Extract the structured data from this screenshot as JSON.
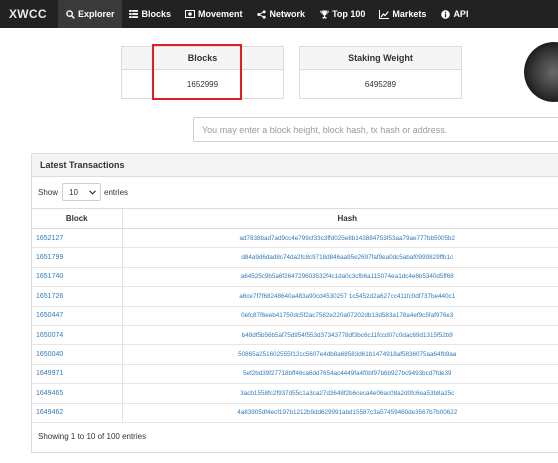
{
  "navbar": {
    "brand": "XWCC",
    "items": [
      {
        "label": "Explorer",
        "icon": "search-icon",
        "active": true
      },
      {
        "label": "Blocks",
        "icon": "grid-icon",
        "active": false
      },
      {
        "label": "Movement",
        "icon": "money-icon",
        "active": false
      },
      {
        "label": "Network",
        "icon": "share-icon",
        "active": false
      },
      {
        "label": "Top 100",
        "icon": "trophy-icon",
        "active": false
      },
      {
        "label": "Markets",
        "icon": "chart-icon",
        "active": false
      },
      {
        "label": "API",
        "icon": "info-icon",
        "active": false
      }
    ]
  },
  "stats": {
    "blocks": {
      "title": "Blocks",
      "value": "1652999"
    },
    "staking": {
      "title": "Staking Weight",
      "value": "6495289"
    }
  },
  "search": {
    "placeholder": "You may enter a block height, block hash, tx hash or address."
  },
  "transactions": {
    "title": "Latest Transactions",
    "show_label": "Show",
    "page_size": "10",
    "entries_label": "entries",
    "columns": {
      "block": "Block",
      "hash": "Hash"
    },
    "rows": [
      {
        "block": "1652127",
        "hash": "ad7838bad7ad9cc4e799cf33c3ffd025e8b143884753f53aa79ae777bb5005b2"
      },
      {
        "block": "1651799",
        "hash": "d84a9d6dad8c74da2fc8c9718d846aa95e2697faf9ea0dc5abaf0999829ffb1c"
      },
      {
        "block": "1651740",
        "hash": "a64525c9b5a6f264729603532f4c1da0c3cfb6a115074ea1dc4e6b5340d5ff68"
      },
      {
        "block": "1651726",
        "hash": "a6ce7f7f68248640a483a90cd4530257 1c5452d2a627cc411fc0df737be440c1"
      },
      {
        "block": "1650447",
        "hash": "0efc87f6eeb41750dc5f2ac7582e220a07202db13d583a178a4ef9c5faf976e3"
      },
      {
        "block": "1650074",
        "hash": "b48df5b56b5af75d954f553d37343778df3bc6c11fccd07c0dac69d1315f52b9"
      },
      {
        "block": "1650040",
        "hash": "50865a251602555f12cc5607e4db8a68583d61b1474918af5836075aa64fb9aa"
      },
      {
        "block": "1649971",
        "hash": "5ef2bd39f27718bff46ca6dd7654ac4449fa4f0bf97b6b927bc9493bcd7fde39"
      },
      {
        "block": "1649465",
        "hash": "3acb1558fc2f937d55c1a3ca27d3648f2b6ceca4e06ac08a2d0fc6ea53b8a25c"
      },
      {
        "block": "1649462",
        "hash": "4a83905df4ecf197b1212b9dd629991abd15587c3a57459460de3567b7b00622"
      }
    ],
    "info": "Showing 1 to 10 of 100 entries"
  }
}
